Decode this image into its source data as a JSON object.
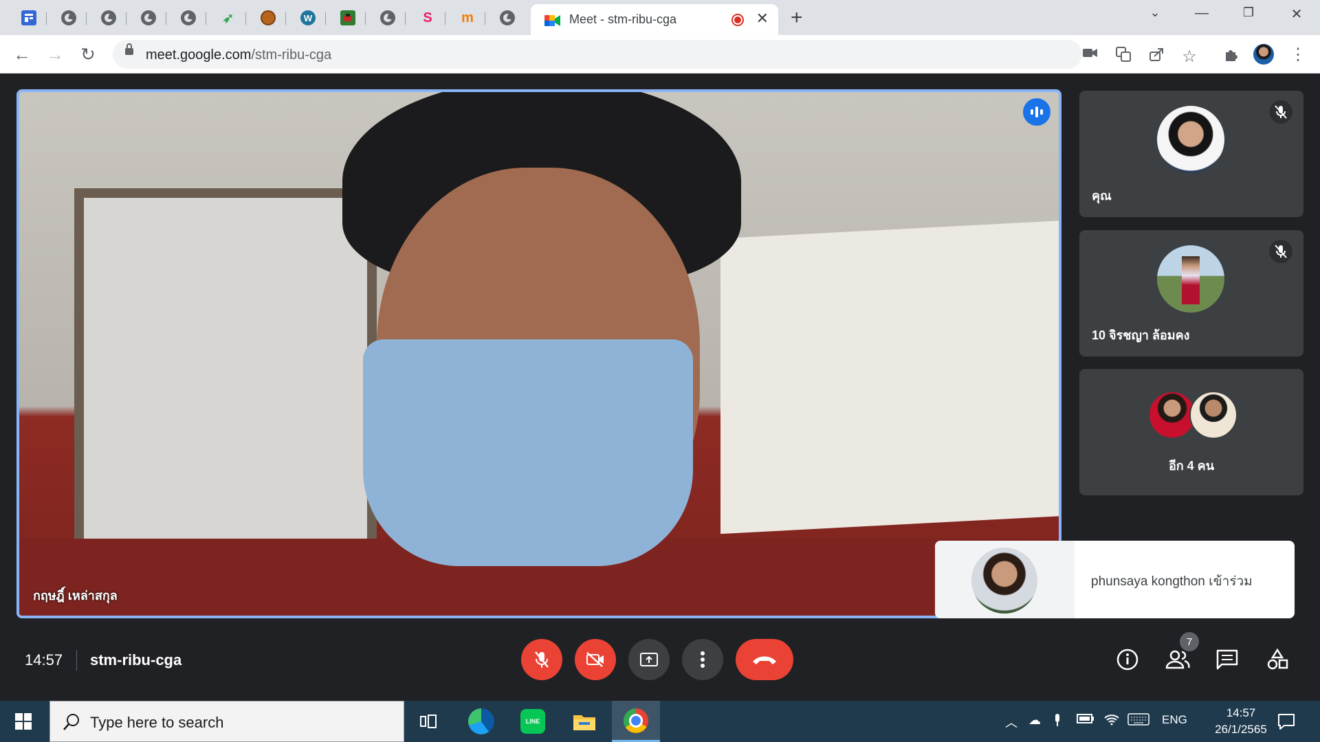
{
  "browser": {
    "active_tab_title": "Meet - stm-ribu-cga",
    "url_host": "meet.google.com",
    "url_path": "/stm-ribu-cga",
    "pinned_tabs": [
      "calendar-icon",
      "globe-icon",
      "globe-icon",
      "globe-icon",
      "globe-icon",
      "leaf-icon",
      "seal-icon",
      "wordpress-icon",
      "image-icon",
      "globe-icon",
      "s-icon",
      "m-icon",
      "globe-icon"
    ],
    "wp_letter": "W",
    "s_letter": "S",
    "m_letter": "m"
  },
  "meet": {
    "main_speaker_name": "กฤษฎิ์ เหล่าสกุล",
    "tiles": [
      {
        "name": "คุณ",
        "muted": true
      },
      {
        "name": "10 จิรชญา ล้อมคง",
        "muted": true
      },
      {
        "name": "อีก 4 คน",
        "muted": false
      }
    ],
    "notification": "phunsaya kongthon เข้าร่วม",
    "time": "14:57",
    "meeting_code": "stm-ribu-cga",
    "participant_count": "7",
    "colors": {
      "accent": "#8ab4f8",
      "danger": "#ea4335",
      "tile": "#3c4043",
      "bg": "#202124"
    }
  },
  "taskbar": {
    "search_placeholder": "Type here to search",
    "language": "ENG",
    "clock_time": "14:57",
    "clock_date": "26/1/2565",
    "line_label": "LINE"
  }
}
